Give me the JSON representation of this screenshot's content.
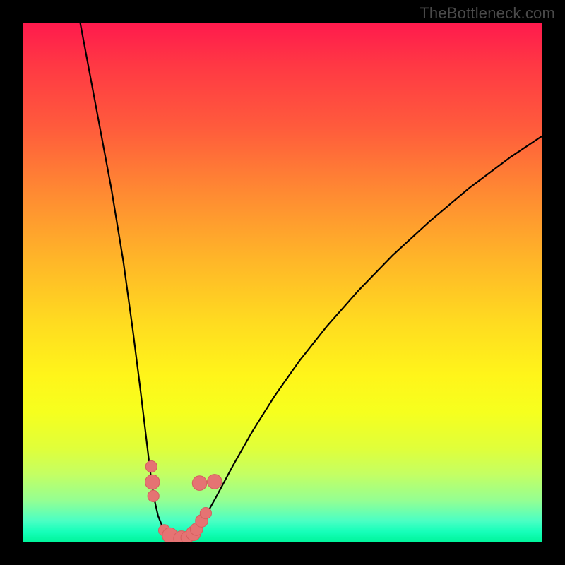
{
  "watermark": "TheBottleneck.com",
  "colors": {
    "background_black": "#000000",
    "gradient_top": "#ff1a4d",
    "gradient_bottom": "#00f59c",
    "curve_stroke": "#000000",
    "marker_fill": "#e57373",
    "marker_stroke": "#d55e5e"
  },
  "chart_data": {
    "type": "line",
    "title": "",
    "xlabel": "",
    "ylabel": "",
    "xlim": [
      0,
      100
    ],
    "ylim": [
      0,
      100
    ],
    "note": "No numeric axes are shown in the image; x and y are normalized 0–100 estimates read from pixel position.",
    "series": [
      {
        "name": "bottleneck-curve",
        "x": [
          11.0,
          14.0,
          17.0,
          19.3,
          21.1,
          22.5,
          23.6,
          24.5,
          25.2,
          26.0,
          27.0,
          28.0,
          29.0,
          30.0,
          31.3,
          32.6,
          34.0,
          35.5,
          37.2,
          40.5,
          44.2,
          48.4,
          53.2,
          58.6,
          64.6,
          71.2,
          78.4,
          86.0,
          94.0,
          100.0
        ],
        "y": [
          100.0,
          84.0,
          68.0,
          54.0,
          41.0,
          30.0,
          21.0,
          13.5,
          8.5,
          5.0,
          2.5,
          1.2,
          0.6,
          0.4,
          0.6,
          1.5,
          3.2,
          5.6,
          8.6,
          14.8,
          21.3,
          28.0,
          34.8,
          41.6,
          48.4,
          55.2,
          61.8,
          68.2,
          74.2,
          78.2
        ]
      }
    ],
    "markers": [
      {
        "x": 24.7,
        "y": 14.5,
        "r": 1.1
      },
      {
        "x": 24.9,
        "y": 11.5,
        "r": 1.4
      },
      {
        "x": 25.1,
        "y": 8.8,
        "r": 1.1
      },
      {
        "x": 27.2,
        "y": 2.2,
        "r": 1.1
      },
      {
        "x": 28.3,
        "y": 1.2,
        "r": 1.5
      },
      {
        "x": 30.5,
        "y": 0.6,
        "r": 1.5
      },
      {
        "x": 31.6,
        "y": 0.8,
        "r": 1.2
      },
      {
        "x": 32.8,
        "y": 1.6,
        "r": 1.4
      },
      {
        "x": 33.4,
        "y": 2.4,
        "r": 1.2
      },
      {
        "x": 34.4,
        "y": 4.0,
        "r": 1.2
      },
      {
        "x": 35.2,
        "y": 5.5,
        "r": 1.1
      },
      {
        "x": 34.0,
        "y": 11.3,
        "r": 1.4
      },
      {
        "x": 36.9,
        "y": 11.6,
        "r": 1.4
      }
    ]
  }
}
